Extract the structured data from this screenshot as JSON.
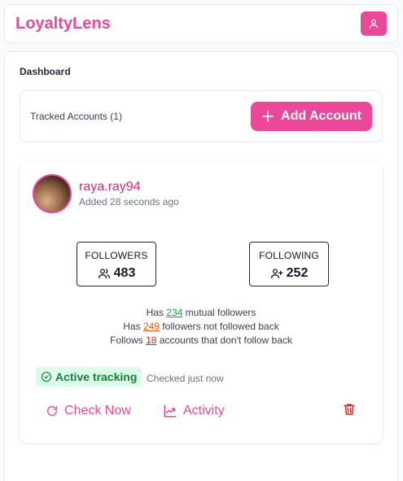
{
  "app": {
    "title": "LoyaltyLens",
    "brand_color": "#ec4899"
  },
  "header": {
    "user_icon": "user-icon"
  },
  "dashboard": {
    "title": "Dashboard",
    "tracked_label": "Tracked Accounts (1)",
    "add_button_label": "Add Account"
  },
  "account": {
    "username": "raya.ray94",
    "added": "Added 28 seconds ago",
    "followers_label": "FOLLOWERS",
    "followers": "483",
    "following_label": "FOLLOWING",
    "following": "252",
    "mutual": {
      "prefix": "Has ",
      "value": "234",
      "suffix": " mutual followers"
    },
    "not_followed_back": {
      "prefix": "Has ",
      "value": "249",
      "suffix": " followers not followed back"
    },
    "dont_follow_back": {
      "prefix": "Follows ",
      "value": "18",
      "suffix": " accounts that don't follow back"
    },
    "status": "Active tracking",
    "checked": "Checked just now",
    "check_now_label": "Check Now",
    "activity_label": "Activity"
  }
}
